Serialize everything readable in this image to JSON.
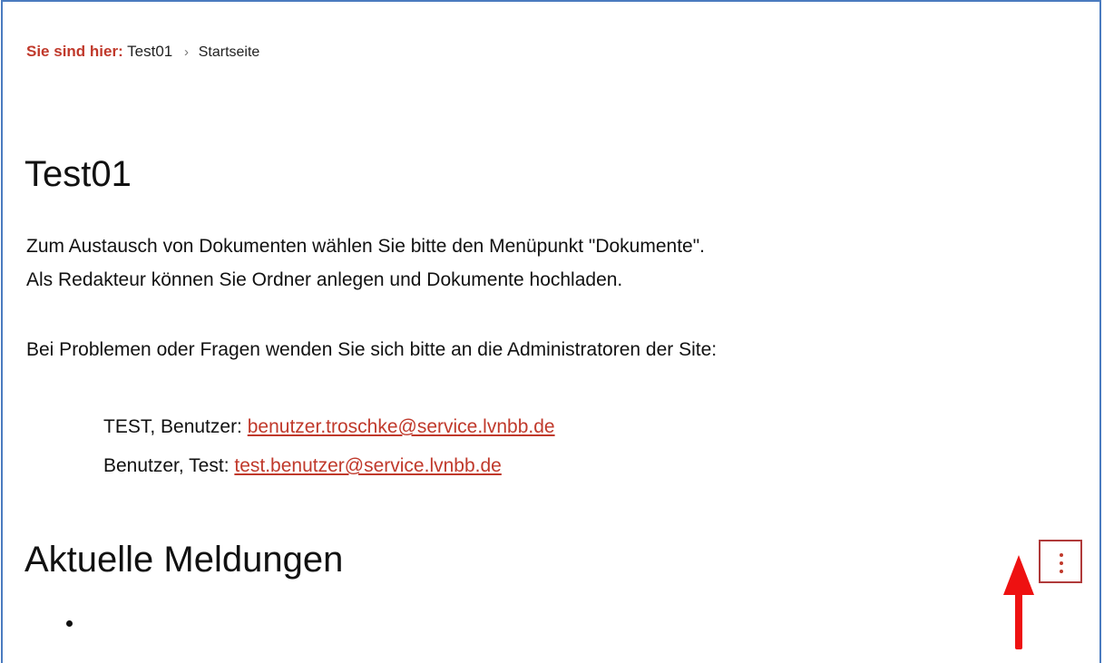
{
  "breadcrumb": {
    "label": "Sie sind hier:",
    "site": "Test01",
    "separator": "›",
    "current": "Startseite"
  },
  "page": {
    "title": "Test01",
    "intro_line1": "Zum Austausch von Dokumenten wählen Sie bitte den Menüpunkt \"Dokumente\".",
    "intro_line2": "Als Redakteur können Sie Ordner anlegen und Dokumente hochladen.",
    "contact_note": "Bei Problemen oder Fragen wenden Sie sich bitte an die Administratoren der Site:"
  },
  "contacts": [
    {
      "name": "TEST, Benutzer:",
      "email": "benutzer.troschke@service.lvnbb.de"
    },
    {
      "name": "Benutzer, Test:",
      "email": "test.benutzer@service.lvnbb.de"
    }
  ],
  "news": {
    "title": "Aktuelle Meldungen",
    "more_icon": "vertical-ellipsis-icon"
  },
  "annotation": {
    "icon": "red-arrow-up-icon"
  },
  "colors": {
    "accent": "#c0392b",
    "frame_border": "#4a7bbf",
    "button_border": "#b03a3a",
    "arrow": "#ee1111"
  }
}
